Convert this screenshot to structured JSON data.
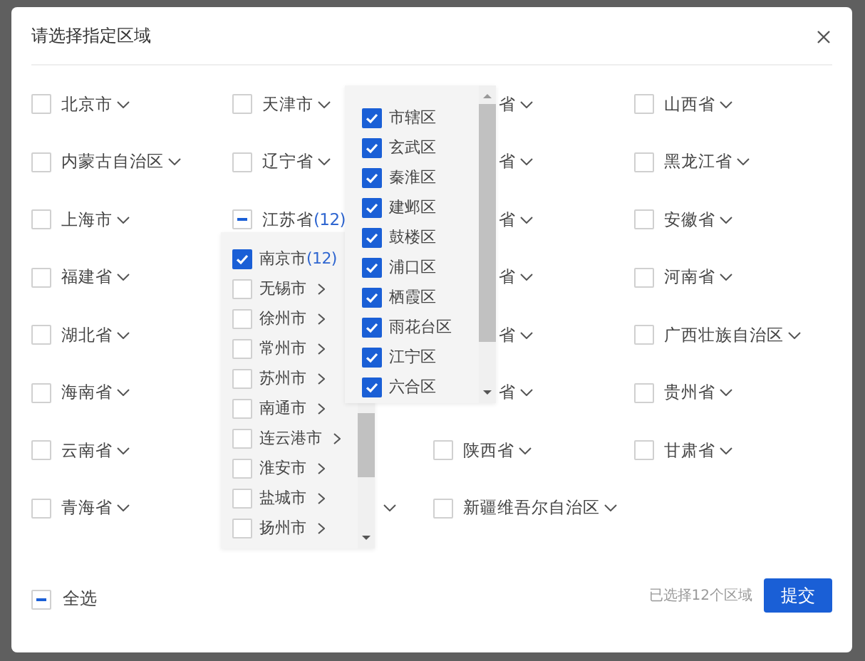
{
  "dialog": {
    "title": "请选择指定区域"
  },
  "regions": [
    {
      "kind": "item",
      "label": "北京市",
      "checked": false
    },
    {
      "kind": "item",
      "label": "天津市",
      "checked": false
    },
    {
      "kind": "clipped",
      "label": "省"
    },
    {
      "kind": "item",
      "label": "山西省",
      "checked": false
    },
    {
      "kind": "item",
      "label": "内蒙古自治区",
      "checked": false
    },
    {
      "kind": "item",
      "label": "辽宁省",
      "checked": false
    },
    {
      "kind": "clipped",
      "label": "省"
    },
    {
      "kind": "item",
      "label": "黑龙江省",
      "checked": false
    },
    {
      "kind": "item",
      "label": "上海市",
      "checked": false
    },
    {
      "kind": "item",
      "label": "江苏省",
      "count": "(12)",
      "indeterminate": true
    },
    {
      "kind": "clipped",
      "label": "省"
    },
    {
      "kind": "item",
      "label": "安徽省",
      "checked": false
    },
    {
      "kind": "item",
      "label": "福建省",
      "checked": false
    },
    {
      "kind": "covered"
    },
    {
      "kind": "clipped",
      "label": "省"
    },
    {
      "kind": "item",
      "label": "河南省",
      "checked": false
    },
    {
      "kind": "item",
      "label": "湖北省",
      "checked": false
    },
    {
      "kind": "covered"
    },
    {
      "kind": "clipped",
      "label": "省"
    },
    {
      "kind": "item",
      "label": "广西壮族自治区",
      "checked": false
    },
    {
      "kind": "item",
      "label": "海南省",
      "checked": false
    },
    {
      "kind": "covered"
    },
    {
      "kind": "clipped",
      "label": "省"
    },
    {
      "kind": "item",
      "label": "贵州省",
      "checked": false
    },
    {
      "kind": "item",
      "label": "云南省",
      "checked": false
    },
    {
      "kind": "covered"
    },
    {
      "kind": "item",
      "label": "陕西省",
      "checked": false
    },
    {
      "kind": "item",
      "label": "甘肃省",
      "checked": false
    },
    {
      "kind": "item",
      "label": "青海省",
      "checked": false
    },
    {
      "kind": "chevron"
    },
    {
      "kind": "item",
      "label": "新疆维吾尔自治区",
      "checked": false
    }
  ],
  "city_menu": {
    "items": [
      {
        "label": "南京市",
        "count": "(12)",
        "checked": true
      },
      {
        "label": "无锡市",
        "checked": false
      },
      {
        "label": "徐州市",
        "checked": false
      },
      {
        "label": "常州市",
        "checked": false
      },
      {
        "label": "苏州市",
        "checked": false
      },
      {
        "label": "南通市",
        "checked": false
      },
      {
        "label": "连云港市",
        "checked": false
      },
      {
        "label": "淮安市",
        "checked": false
      },
      {
        "label": "盐城市",
        "checked": false
      },
      {
        "label": "扬州市",
        "checked": false
      }
    ]
  },
  "district_menu": {
    "items": [
      {
        "label": "市辖区",
        "checked": true
      },
      {
        "label": "玄武区",
        "checked": true
      },
      {
        "label": "秦淮区",
        "checked": true
      },
      {
        "label": "建邺区",
        "checked": true
      },
      {
        "label": "鼓楼区",
        "checked": true
      },
      {
        "label": "浦口区",
        "checked": true
      },
      {
        "label": "栖霞区",
        "checked": true
      },
      {
        "label": "雨花台区",
        "checked": true
      },
      {
        "label": "江宁区",
        "checked": true
      },
      {
        "label": "六合区",
        "checked": true
      }
    ]
  },
  "footer": {
    "select_all": {
      "label": "全选",
      "indeterminate": true
    },
    "summary": "已选择12个区域",
    "submit": "提交"
  }
}
